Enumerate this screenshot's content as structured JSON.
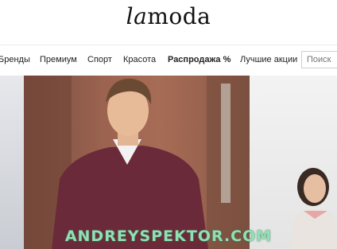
{
  "header": {
    "logo_prefix": "la",
    "logo_suffix": "moda"
  },
  "nav": {
    "items": [
      "Бренды",
      "Премиум",
      "Спорт",
      "Красота",
      "Распродажа %",
      "Лучшие акции"
    ],
    "search_placeholder": "Поиск"
  },
  "watermark": "ANDREYSPEKTOR.COM",
  "colors": {
    "watermark": "#8fe0b3",
    "sweater": "#6b2a3a"
  }
}
